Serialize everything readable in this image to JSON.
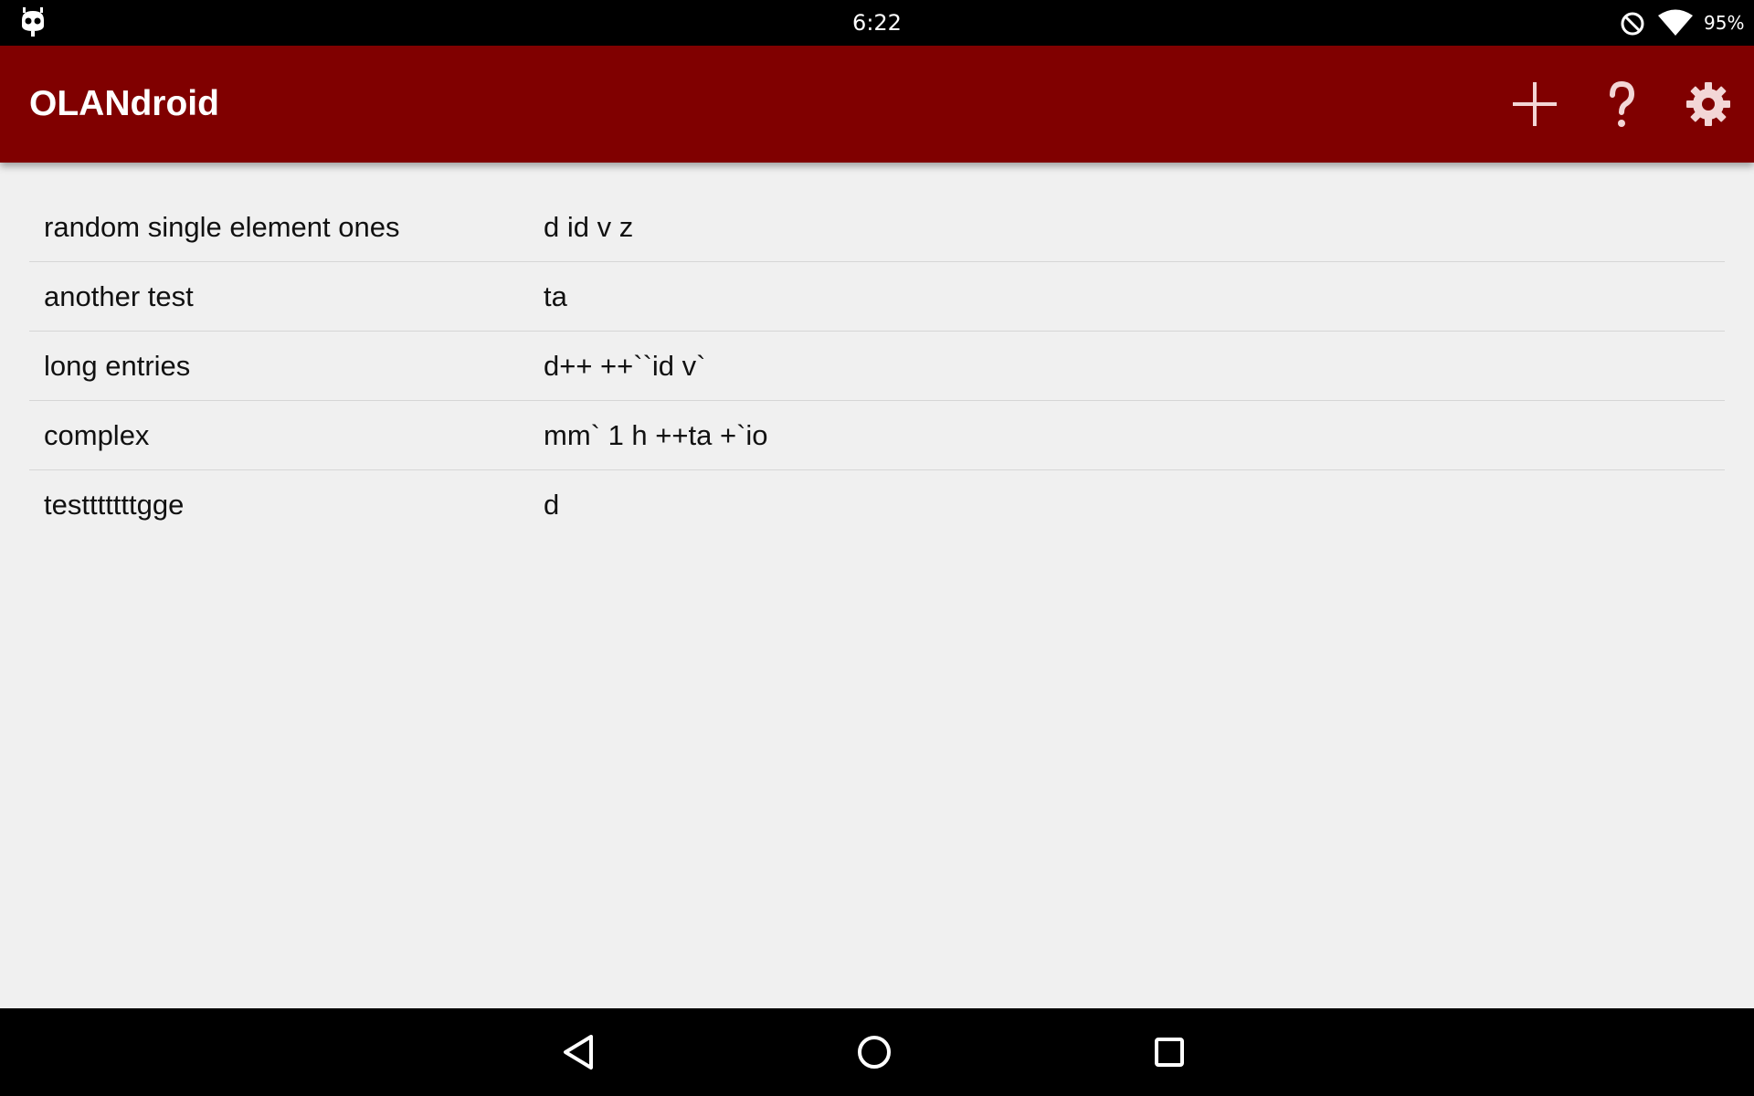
{
  "status_bar": {
    "time": "6:22",
    "battery": "95%",
    "icons": [
      "notification-bug-icon",
      "do-not-disturb-icon",
      "wifi-icon"
    ]
  },
  "app_bar": {
    "title": "OLANdroid",
    "background_color": "#800000",
    "actions": [
      "add-icon",
      "help-icon",
      "settings-icon"
    ]
  },
  "list": {
    "rows": [
      {
        "name": "random single element ones",
        "sequence": "d id v z"
      },
      {
        "name": "another test",
        "sequence": "ta"
      },
      {
        "name": "long entries",
        "sequence": "d++ ++``id v`"
      },
      {
        "name": "complex",
        "sequence": "mm` 1 h ++ta +`io"
      },
      {
        "name": "testttttttgge",
        "sequence": "d"
      }
    ]
  },
  "nav_bar": {
    "buttons": [
      "back-icon",
      "home-icon",
      "recents-icon"
    ]
  }
}
